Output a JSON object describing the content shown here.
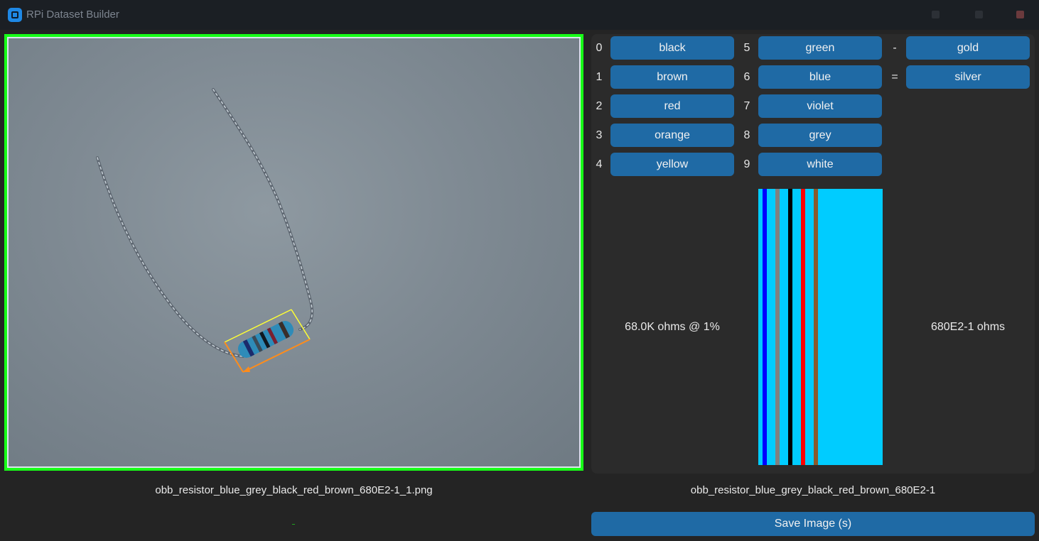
{
  "window": {
    "title": "RPi Dataset Builder"
  },
  "colors": {
    "accent": "#1f6aa5",
    "frame_border": "#18ff18",
    "stripe_background": "#00ccff",
    "obb_top": "#ffff33",
    "obb_side": "#ff8c1a"
  },
  "color_buttons": [
    {
      "digit": "0",
      "label": "black"
    },
    {
      "digit": "1",
      "label": "brown"
    },
    {
      "digit": "2",
      "label": "red"
    },
    {
      "digit": "3",
      "label": "orange"
    },
    {
      "digit": "4",
      "label": "yellow"
    },
    {
      "digit": "5",
      "label": "green"
    },
    {
      "digit": "6",
      "label": "blue"
    },
    {
      "digit": "7",
      "label": "violet"
    },
    {
      "digit": "8",
      "label": "grey"
    },
    {
      "digit": "9",
      "label": "white"
    }
  ],
  "tolerance_buttons": [
    {
      "symbol": "-",
      "label": "gold"
    },
    {
      "symbol": "=",
      "label": "silver"
    }
  ],
  "readout": {
    "value_text": "68.0K ohms @ 1%",
    "code_text": "680E2-1 ohms"
  },
  "bands": [
    {
      "name": "blue",
      "color": "#0000ff"
    },
    {
      "name": "grey",
      "color": "#808080"
    },
    {
      "name": "black",
      "color": "#000000"
    },
    {
      "name": "red",
      "color": "#ff0000"
    },
    {
      "name": "brown",
      "color": "#8b5a2b"
    }
  ],
  "image_filename": "obb_resistor_blue_grey_black_red_brown_680E2-1_1.png",
  "label_name": "obb_resistor_blue_grey_black_red_brown_680E2-1",
  "save_button": {
    "label": "Save Image (s)"
  }
}
